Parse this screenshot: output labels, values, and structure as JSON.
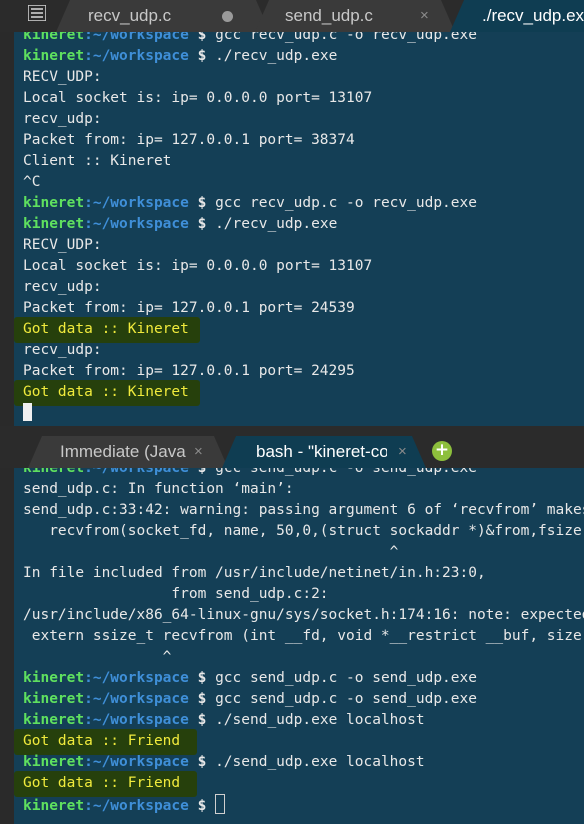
{
  "top_tabs": [
    {
      "label": "recv_udp.c",
      "status": "x"
    },
    {
      "label": "send_udp.c",
      "status": "×"
    },
    {
      "label": "./recv_udp.exe"
    }
  ],
  "top_tabs_modified_icon": "modified-dot-icon",
  "bottom_tabs": [
    {
      "label": "Immediate (Java",
      "close": "×"
    },
    {
      "label": "bash - \"kineret-co",
      "close": "×"
    }
  ],
  "add_tab_label": "+",
  "prompt": {
    "user": "kineret",
    "path": ":~/workspace",
    "sign": " $ "
  },
  "top_terminal": {
    "lines": [
      {
        "type": "cmd",
        "text": "gcc recv_udp.c -o recv_udp.exe"
      },
      {
        "type": "cmd",
        "text": "./recv_udp.exe"
      },
      {
        "type": "out",
        "text": "RECV_UDP:"
      },
      {
        "type": "out",
        "text": "Local socket is: ip= 0.0.0.0 port= 13107"
      },
      {
        "type": "out",
        "text": "recv_udp:"
      },
      {
        "type": "out",
        "text": "Packet from: ip= 127.0.0.1 port= 38374"
      },
      {
        "type": "out",
        "text": "Client :: Kineret"
      },
      {
        "type": "out",
        "text": "^C"
      },
      {
        "type": "cmd",
        "text": "gcc recv_udp.c -o recv_udp.exe"
      },
      {
        "type": "cmd",
        "text": "./recv_udp.exe"
      },
      {
        "type": "out",
        "text": "RECV_UDP:"
      },
      {
        "type": "out",
        "text": "Local socket is: ip= 0.0.0.0 port= 13107"
      },
      {
        "type": "out",
        "text": "recv_udp:"
      },
      {
        "type": "out",
        "text": "Packet from: ip= 127.0.0.1 port= 24539"
      },
      {
        "type": "hl",
        "text": "Got data :: Kineret"
      },
      {
        "type": "out",
        "text": "recv_udp:"
      },
      {
        "type": "out",
        "text": "Packet from: ip= 127.0.0.1 port= 24295"
      },
      {
        "type": "hl",
        "text": "Got data :: Kineret"
      },
      {
        "type": "cursor"
      }
    ]
  },
  "bottom_terminal": {
    "lines": [
      {
        "type": "cmd",
        "text": "gcc send_udp.c -o send_udp.exe"
      },
      {
        "type": "out",
        "text": "send_udp.c: In function ‘main’:"
      },
      {
        "type": "out",
        "text": "send_udp.c:33:42: warning: passing argument 6 of ‘recvfrom’ makes"
      },
      {
        "type": "out",
        "text": "   recvfrom(socket_fd, name, 50,0,(struct sockaddr *)&from,fsize"
      },
      {
        "type": "out",
        "text": "                                          ^"
      },
      {
        "type": "out",
        "text": "In file included from /usr/include/netinet/in.h:23:0,"
      },
      {
        "type": "out",
        "text": "                 from send_udp.c:2:"
      },
      {
        "type": "out",
        "text": "/usr/include/x86_64-linux-gnu/sys/socket.h:174:16: note: expected"
      },
      {
        "type": "out",
        "text": " extern ssize_t recvfrom (int __fd, void *__restrict __buf, size"
      },
      {
        "type": "out",
        "text": "                ^"
      },
      {
        "type": "cmd",
        "text": "gcc send_udp.c -o send_udp.exe"
      },
      {
        "type": "cmd",
        "text": "gcc send_udp.c -o send_udp.exe"
      },
      {
        "type": "cmd",
        "text": "./send_udp.exe localhost"
      },
      {
        "type": "hl",
        "text": "Got data :: Friend"
      },
      {
        "type": "cmd",
        "text": "./send_udp.exe localhost"
      },
      {
        "type": "hl",
        "text": "Got data :: Friend"
      },
      {
        "type": "cmdcursor",
        "text": ""
      }
    ]
  }
}
